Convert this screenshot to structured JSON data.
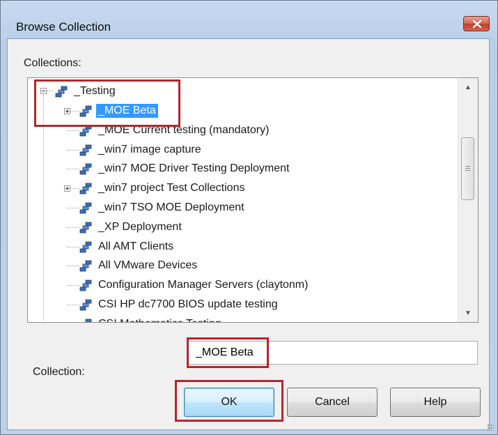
{
  "window": {
    "title": "Browse Collection"
  },
  "labels": {
    "collections": "Collections:",
    "collection": "Collection:"
  },
  "tree": {
    "root": "_Testing",
    "items": [
      "_MOE Beta",
      "_MOE Current testing (mandatory)",
      "_win7 image capture",
      "_win7 MOE Driver Testing Deployment",
      "_win7 project Test Collections",
      "_win7 TSO MOE Deployment",
      "_XP Deployment",
      "All AMT Clients",
      "All VMware Devices",
      "Configuration Manager Servers (claytonm)",
      "CSI HP dc7700 BIOS update testing",
      "CSI Mathematics Testing"
    ],
    "selected": "_MOE Beta"
  },
  "collection_input": {
    "value": "_MOE Beta"
  },
  "buttons": {
    "ok": "OK",
    "cancel": "Cancel",
    "help": "Help"
  },
  "colors": {
    "selection": "#3399ff",
    "highlight_box": "#b3272d"
  },
  "icons": {
    "collection": "collection-icon",
    "close": "close-icon",
    "scroll_up": "scroll-up-arrow-icon",
    "scroll_down": "scroll-down-arrow-icon"
  }
}
